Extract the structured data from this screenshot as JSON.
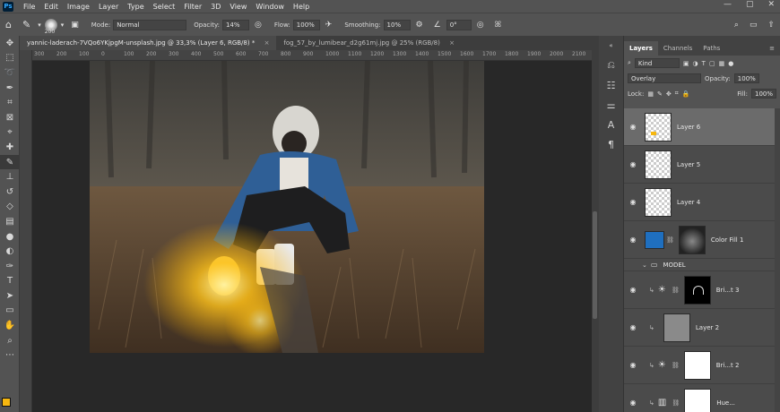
{
  "menu": [
    "File",
    "Edit",
    "Image",
    "Layer",
    "Type",
    "Select",
    "Filter",
    "3D",
    "View",
    "Window",
    "Help"
  ],
  "window_controls": [
    "—",
    "▢",
    "✕"
  ],
  "app_logo": "Ps",
  "options": {
    "brush_size": "200",
    "mode_label": "Mode:",
    "mode_value": "Normal",
    "opacity_label": "Opacity:",
    "opacity_value": "14%",
    "flow_label": "Flow:",
    "flow_value": "100%",
    "smoothing_label": "Smoothing:",
    "smoothing_value": "10%",
    "angle_value": "0°"
  },
  "tabs": [
    {
      "label": "yannic-laderach-7VQo6YKjpgM-unsplash.jpg @ 33,3% (Layer 6, RGB/8) *",
      "close": "×"
    },
    {
      "label": "fog_57_by_lumibear_d2g61mj.jpg @ 25% (RGB/8)",
      "close": "×"
    }
  ],
  "ruler": [
    "300",
    "200",
    "100",
    "0",
    "100",
    "200",
    "300",
    "400",
    "500",
    "600",
    "700",
    "800",
    "900",
    "1000",
    "1100",
    "1200",
    "1300",
    "1400",
    "1500",
    "1600",
    "1700",
    "1800",
    "1900",
    "2000",
    "2100"
  ],
  "layers_panel": {
    "tabs": [
      "Layers",
      "Channels",
      "Paths"
    ],
    "filter_kind": "Kind",
    "blend_mode": "Overlay",
    "opacity_label": "Opacity:",
    "opacity_value": "100%",
    "lock_label": "Lock:",
    "fill_label": "Fill:",
    "fill_value": "100%",
    "layers": [
      {
        "name": "Layer 6",
        "selected": true
      },
      {
        "name": "Layer 5"
      },
      {
        "name": "Layer 4"
      },
      {
        "name": "Color Fill 1"
      },
      {
        "name": "MODEL",
        "group": true
      },
      {
        "name": "Bri...t 3"
      },
      {
        "name": "Layer 2"
      },
      {
        "name": "Bri...t 2"
      },
      {
        "name": "Hue..."
      }
    ]
  },
  "colors": {
    "foreground": "#f6b710",
    "background": "#ffffff",
    "ui_bg": "#535353",
    "canvas_bg": "#282828"
  }
}
